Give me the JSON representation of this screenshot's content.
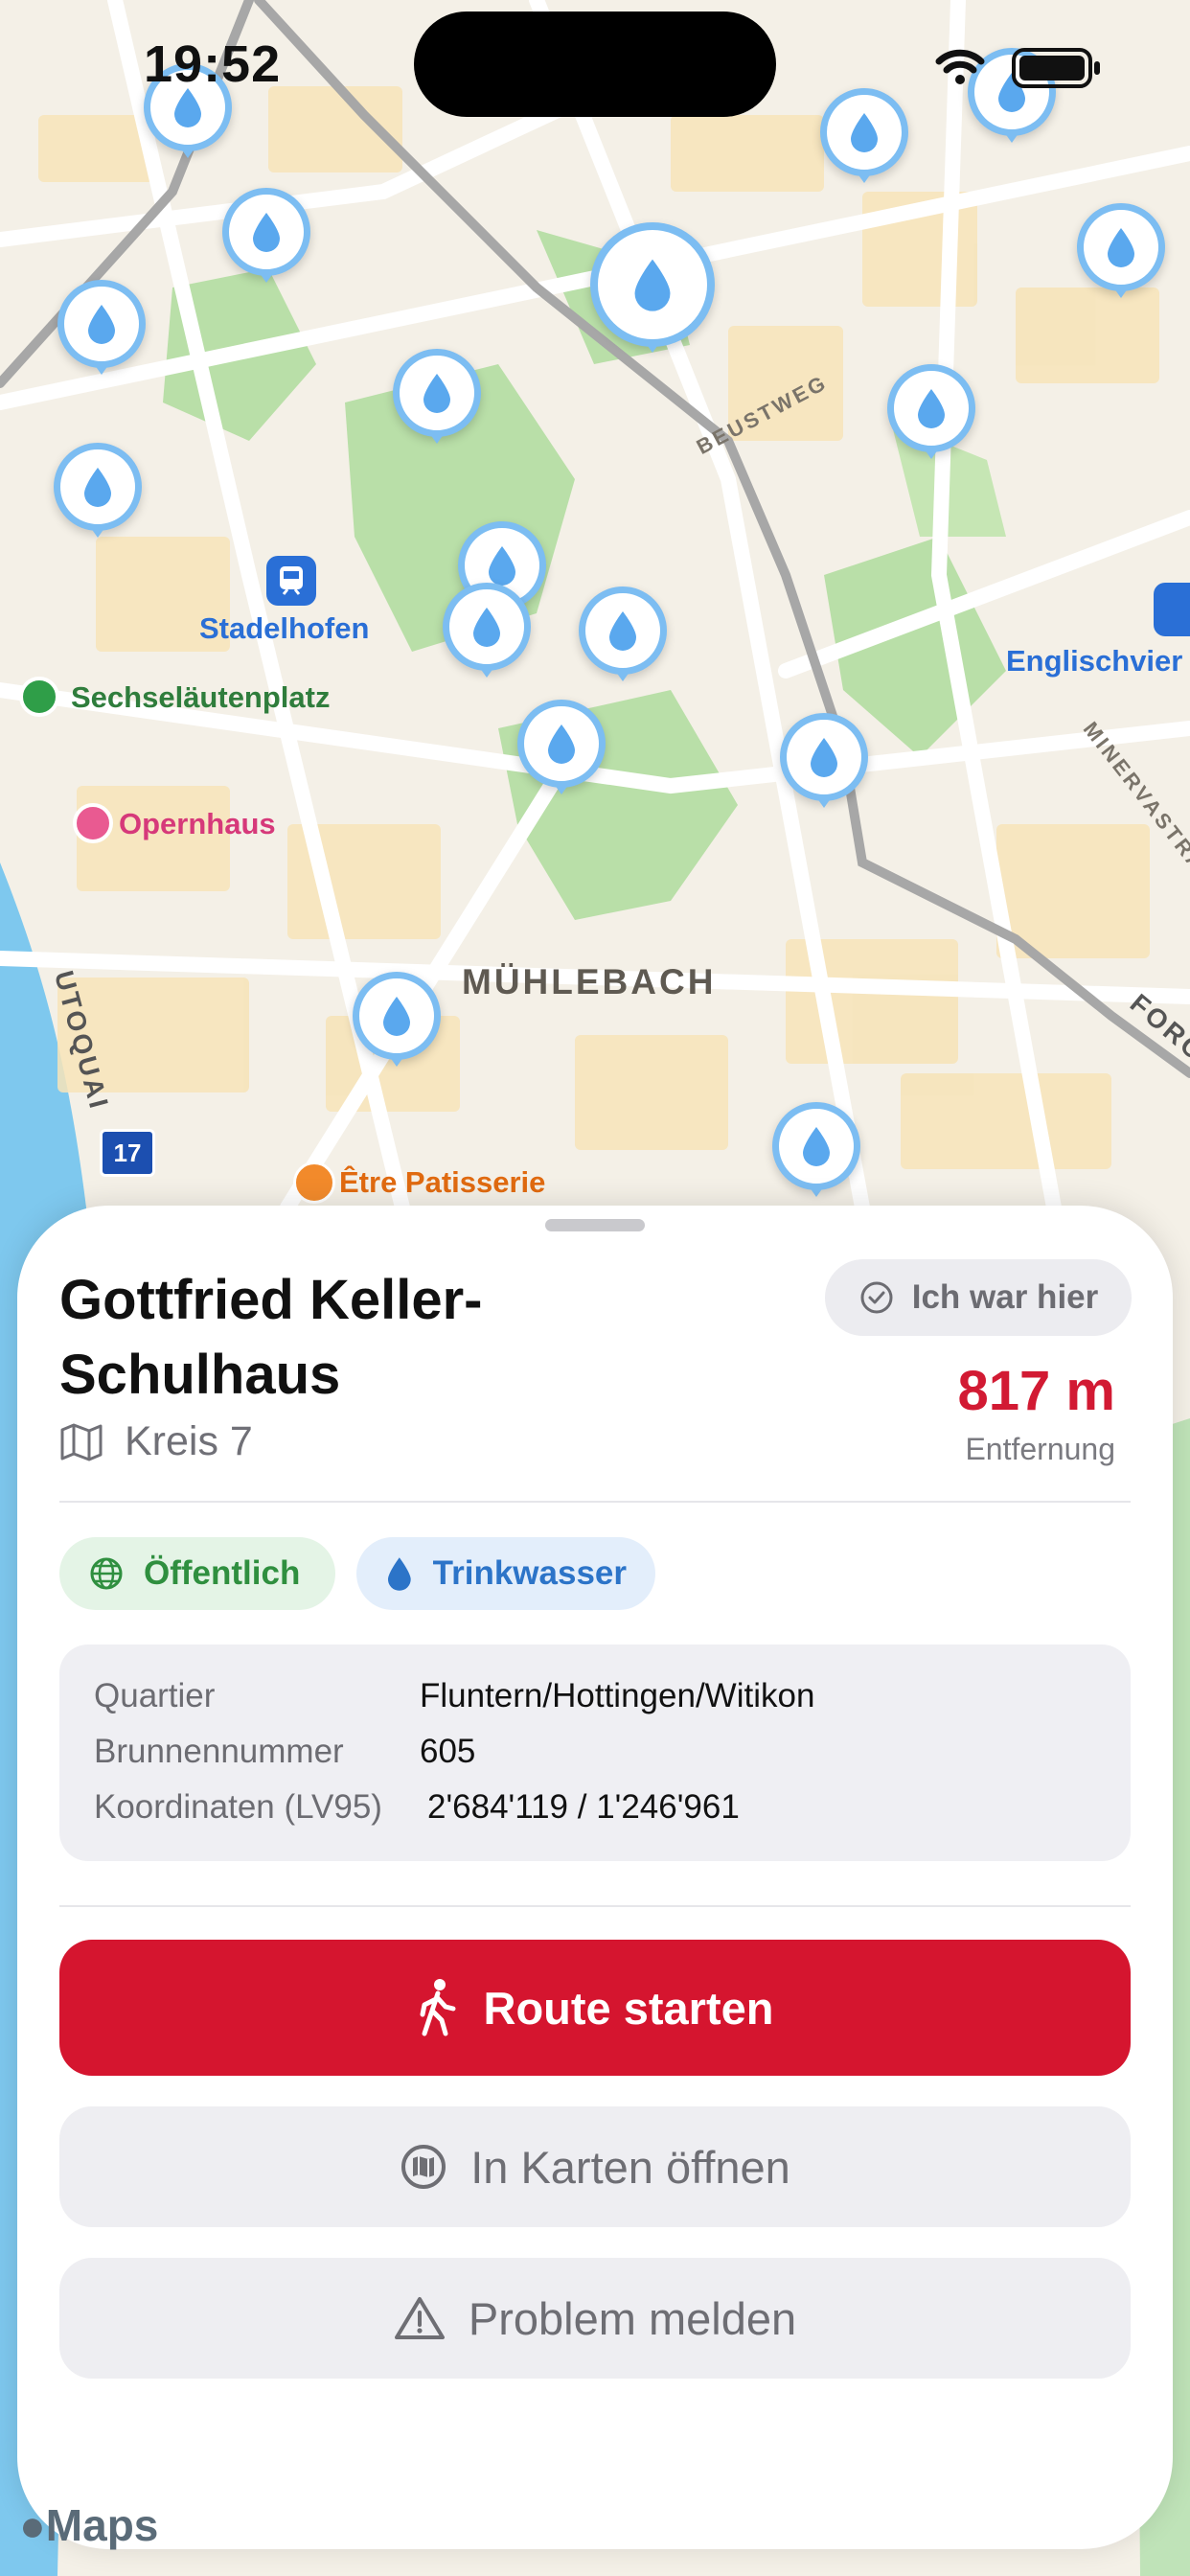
{
  "status": {
    "time": "19:52"
  },
  "map": {
    "labels": {
      "stadelhofen": "Stadelhofen",
      "sechselaeutenplatz": "Sechseläutenplatz",
      "opernhaus": "Opernhaus",
      "englischviertel": "Englischvier",
      "muehlebach": "MÜHLEBACH",
      "etre_patisserie": "Être Patisserie",
      "beustweg": "BEUSTWEG",
      "minervastrasse": "MINERVASTRASSE",
      "utoquai": "UTOQUAI",
      "forch": "FORCH",
      "tram_line": "17"
    },
    "attribution": "Maps"
  },
  "detail": {
    "title": "Gottfried Keller-Schulhaus",
    "area": "Kreis 7",
    "visited_label": "Ich war hier",
    "distance": "817 m",
    "distance_label": "Entfernung",
    "chips": {
      "public": "Öffentlich",
      "water": "Trinkwasser"
    },
    "info": {
      "quartier_key": "Quartier",
      "quartier_val": "Fluntern/Hottingen/Witikon",
      "nummer_key": "Brunnennummer",
      "nummer_val": "605",
      "koord_key": "Koordinaten (LV95)",
      "koord_val": "2'684'119 / 1'246'961"
    },
    "buttons": {
      "route": "Route starten",
      "maps": "In Karten öffnen",
      "report": "Problem melden"
    }
  },
  "colors": {
    "accent": "#d5152f",
    "pin_ring": "#7cbdf2",
    "water_blue": "#2c74c8",
    "public_green": "#2f8f3f"
  }
}
